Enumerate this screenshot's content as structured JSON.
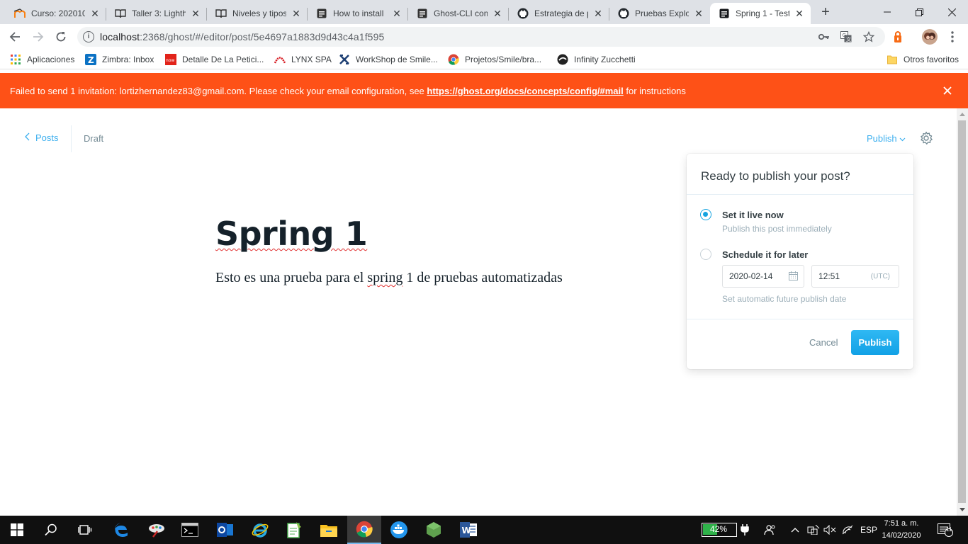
{
  "browser": {
    "tabs": [
      {
        "title": "Curso: 202010",
        "icon": "moodle-icon"
      },
      {
        "title": "Taller 3: Lighth",
        "icon": "book-icon"
      },
      {
        "title": "Niveles y tipos",
        "icon": "book-icon"
      },
      {
        "title": "How to install",
        "icon": "doc-icon"
      },
      {
        "title": "Ghost-CLI com",
        "icon": "doc-icon"
      },
      {
        "title": "Estrategia de p",
        "icon": "github-icon"
      },
      {
        "title": "Pruebas Explor",
        "icon": "github-icon"
      },
      {
        "title": "Spring 1 - Test",
        "icon": "ghost-icon",
        "active": true
      }
    ],
    "url_host": "localhost",
    "url_rest": ":2368/ghost/#/editor/post/5e4697a1883d9d43c4a1f595",
    "bookmarks": [
      {
        "label": "Aplicaciones",
        "icon": "apps-grid-icon"
      },
      {
        "label": "Zimbra: Inbox",
        "icon": "zimbra-icon"
      },
      {
        "label": "Detalle De La Petici...",
        "icon": "servicenow-icon"
      },
      {
        "label": "LYNX SPA",
        "icon": "lynx-icon"
      },
      {
        "label": "WorkShop de Smile...",
        "icon": "workshop-icon"
      },
      {
        "label": "Projetos/Smile/bra...",
        "icon": "chrome-icon"
      },
      {
        "label": "Infinity Zucchetti",
        "icon": "infinity-icon"
      }
    ],
    "other_bookmarks": "Otros favoritos"
  },
  "alert": {
    "message": "Failed to send 1 invitation: lortizhernandez83@gmail.com. Please check your email configuration, see ",
    "link": "https://ghost.org/docs/concepts/config/#mail",
    "suffix": " for instructions"
  },
  "editor": {
    "back_label": "Posts",
    "status": "Draft",
    "publish_label": "Publish",
    "title": "Spring 1",
    "body_pre": "Esto es una prueba para el ",
    "body_misspelled": "spring",
    "body_post": " 1 de pruebas automatizadas"
  },
  "publish_menu": {
    "heading": "Ready to publish your post?",
    "option_now_title": "Set it live now",
    "option_now_desc": "Publish this post immediately",
    "option_later_title": "Schedule it for later",
    "date_value": "2020-02-14",
    "time_value": "12:51",
    "timezone": "(UTC)",
    "schedule_hint": "Set automatic future publish date",
    "cancel_label": "Cancel",
    "publish_button": "Publish",
    "selected_option": "now"
  },
  "taskbar": {
    "battery_percent": "42%",
    "language": "ESP",
    "time": "7:51 a. m.",
    "date": "14/02/2020",
    "notification_count": "11"
  },
  "colors": {
    "alert_bg": "#fe5117",
    "ghost_blue": "#3eb0ef",
    "publish_btn": "#14a9f0"
  }
}
